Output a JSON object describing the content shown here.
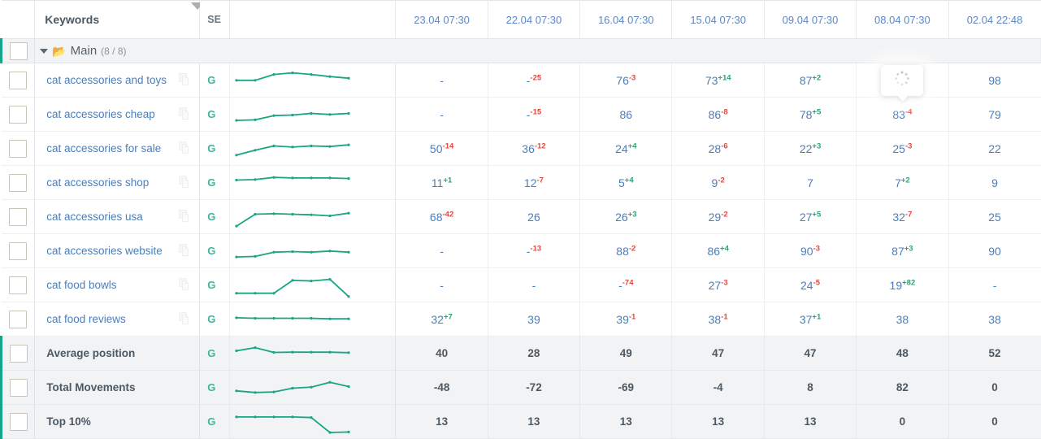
{
  "table": {
    "columns": {
      "keywords_label": "Keywords",
      "se_label": "SE",
      "dates": [
        "23.04 07:30",
        "22.04 07:30",
        "16.04 07:30",
        "15.04 07:30",
        "09.04 07:30",
        "08.04 07:30",
        "02.04 22:48"
      ]
    },
    "group": {
      "name": "Main",
      "count": "(8 / 8)",
      "expand_icon": "chevron-down-icon",
      "folder_icon": "folder-open-icon"
    },
    "icons": {
      "copy": "copy-icon",
      "sort": "sort-descending-icon",
      "checkbox": "checkbox-icon",
      "spinner": "loading-spinner-icon"
    },
    "search_engine": "G",
    "rows": [
      {
        "keyword": "cat accessories and toys",
        "se": "G",
        "sparkline": [
          52,
          52,
          74,
          80,
          74,
          66,
          60
        ],
        "cells": [
          {
            "value": "-",
            "delta": ""
          },
          {
            "value": "-",
            "delta": "-25"
          },
          {
            "value": "76",
            "delta": "-3"
          },
          {
            "value": "73",
            "delta": "+14"
          },
          {
            "value": "87",
            "delta": "+2"
          },
          {
            "value": "",
            "delta": "",
            "loading": true
          },
          {
            "value": "98",
            "delta": ""
          }
        ]
      },
      {
        "keyword": "cat accessories cheap",
        "se": "G",
        "sparkline": [
          30,
          32,
          48,
          50,
          56,
          52,
          56
        ],
        "cells": [
          {
            "value": "-",
            "delta": ""
          },
          {
            "value": "-",
            "delta": "-15"
          },
          {
            "value": "86",
            "delta": ""
          },
          {
            "value": "86",
            "delta": "-8"
          },
          {
            "value": "78",
            "delta": "+5"
          },
          {
            "value": "83",
            "delta": "-4"
          },
          {
            "value": "79",
            "delta": ""
          }
        ]
      },
      {
        "keyword": "cat accessories for sale",
        "se": "G",
        "sparkline": [
          28,
          46,
          62,
          58,
          62,
          60,
          66
        ],
        "cells": [
          {
            "value": "50",
            "delta": "-14"
          },
          {
            "value": "36",
            "delta": "-12"
          },
          {
            "value": "24",
            "delta": "+4"
          },
          {
            "value": "28",
            "delta": "-6"
          },
          {
            "value": "22",
            "delta": "+3"
          },
          {
            "value": "25",
            "delta": "-3"
          },
          {
            "value": "22",
            "delta": ""
          }
        ]
      },
      {
        "keyword": "cat accessories shop",
        "se": "G",
        "sparkline": [
          62,
          64,
          72,
          70,
          70,
          70,
          68
        ],
        "cells": [
          {
            "value": "11",
            "delta": "+1"
          },
          {
            "value": "12",
            "delta": "-7"
          },
          {
            "value": "5",
            "delta": "+4"
          },
          {
            "value": "9",
            "delta": "-2"
          },
          {
            "value": "7",
            "delta": ""
          },
          {
            "value": "7",
            "delta": "+2"
          },
          {
            "value": "9",
            "delta": ""
          }
        ]
      },
      {
        "keyword": "cat accessories usa",
        "se": "G",
        "sparkline": [
          18,
          62,
          64,
          62,
          60,
          56,
          66
        ],
        "cells": [
          {
            "value": "68",
            "delta": "-42"
          },
          {
            "value": "26",
            "delta": ""
          },
          {
            "value": "26",
            "delta": "+3"
          },
          {
            "value": "29",
            "delta": "-2"
          },
          {
            "value": "27",
            "delta": "+5"
          },
          {
            "value": "32",
            "delta": "-7"
          },
          {
            "value": "25",
            "delta": ""
          }
        ]
      },
      {
        "keyword": "cat accessories website",
        "se": "G",
        "sparkline": [
          30,
          32,
          48,
          50,
          48,
          52,
          48
        ],
        "cells": [
          {
            "value": "-",
            "delta": ""
          },
          {
            "value": "-",
            "delta": "-13"
          },
          {
            "value": "88",
            "delta": "-2"
          },
          {
            "value": "86",
            "delta": "+4"
          },
          {
            "value": "90",
            "delta": "-3"
          },
          {
            "value": "87",
            "delta": "+3"
          },
          {
            "value": "90",
            "delta": ""
          }
        ]
      },
      {
        "keyword": "cat food bowls",
        "se": "G",
        "sparkline": [
          22,
          22,
          22,
          70,
          68,
          74,
          10
        ],
        "cells": [
          {
            "value": "-",
            "delta": ""
          },
          {
            "value": "-",
            "delta": ""
          },
          {
            "value": "-",
            "delta": "-74"
          },
          {
            "value": "27",
            "delta": "-3"
          },
          {
            "value": "24",
            "delta": "-5"
          },
          {
            "value": "19",
            "delta": "+82"
          },
          {
            "value": "-",
            "delta": ""
          }
        ]
      },
      {
        "keyword": "cat food reviews",
        "se": "G",
        "sparkline": [
          58,
          56,
          56,
          56,
          56,
          54,
          54
        ],
        "cells": [
          {
            "value": "32",
            "delta": "+7"
          },
          {
            "value": "39",
            "delta": ""
          },
          {
            "value": "39",
            "delta": "-1"
          },
          {
            "value": "38",
            "delta": "-1"
          },
          {
            "value": "37",
            "delta": "+1"
          },
          {
            "value": "38",
            "delta": ""
          },
          {
            "value": "38",
            "delta": ""
          }
        ]
      }
    ],
    "summary_rows": [
      {
        "label": "Average position",
        "se": "G",
        "sparkline": [
          62,
          74,
          56,
          57,
          57,
          57,
          55
        ],
        "values": [
          "40",
          "28",
          "49",
          "47",
          "47",
          "48",
          "52"
        ]
      },
      {
        "label": "Total Movements",
        "se": "G",
        "sparkline": [
          40,
          34,
          36,
          50,
          54,
          72,
          56
        ],
        "values": [
          "-48",
          "-72",
          "-69",
          "-4",
          "8",
          "82",
          "0"
        ]
      },
      {
        "label": "Top 10%",
        "se": "G",
        "sparkline": [
          70,
          70,
          70,
          70,
          68,
          12,
          14
        ],
        "values": [
          "13",
          "13",
          "13",
          "13",
          "13",
          "0",
          "0"
        ]
      }
    ]
  },
  "colors": {
    "link": "#4a7ebb",
    "sparkline": "#1aa583",
    "accent": "#17a589",
    "delta_up": "#27a575",
    "delta_down": "#e8453c",
    "header_text": "#4c5862",
    "date_header": "#5b87c4",
    "group_bg": "#f2f3f4"
  }
}
